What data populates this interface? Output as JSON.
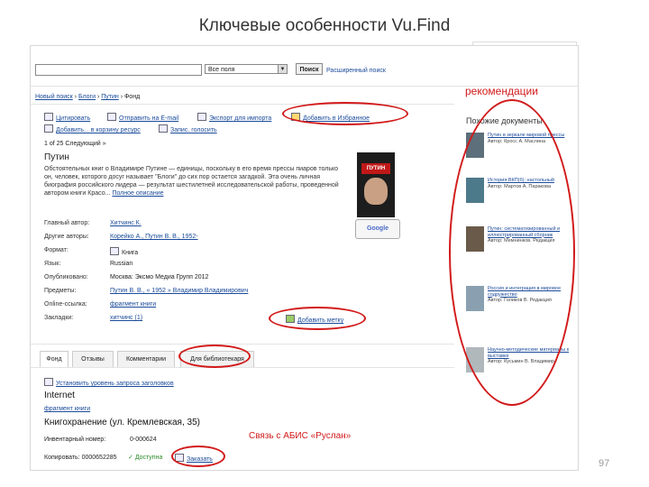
{
  "slide": {
    "title": "Ключевые особенности Vu.Find",
    "page_number": "97"
  },
  "search": {
    "scope": "Все поля",
    "button": "Поиск",
    "advanced": "Расширенный поиск"
  },
  "breadcrumb": [
    "Новый поиск",
    "Блоги",
    "Путин",
    "Фонд"
  ],
  "toolbar": {
    "row1": [
      "Цитировать",
      "Отправить на E-mail",
      "Экспорт для импорта",
      "Добавить в Избранное"
    ],
    "row2": [
      "Добавить... в корзину ресурс",
      "Запис. голосить"
    ]
  },
  "pager": {
    "text": "1 of 25 Следующий »"
  },
  "record": {
    "title": "Путин",
    "description": "Обстоятельных книг о Владимире Путине — единицы, поскольку в его время прессы пиаров только он, человек, которого досуг называет \"Блоги\" до сих пор остается загадкой. Эта очень личная биография российского лидера — результат шестилетней исследовательской работы, проведенной автором книги Красо...",
    "more": "Полное описание",
    "cover_label": "ПУТИН",
    "google_preview": "Google",
    "fields": [
      {
        "label": "Главный автор:",
        "value": "Хитчинс К."
      },
      {
        "label": "Другие авторы:",
        "value": "Корейко А., Путин В. В., 1952-"
      },
      {
        "label": "Формат:",
        "value": "Книга"
      },
      {
        "label": "Язык:",
        "value": "Russian"
      },
      {
        "label": "Опубликовано:",
        "value": "Москва: Эксмо Медиа Групп 2012"
      },
      {
        "label": "Предметы:",
        "value": "Путин В. В., « 1952 » Владимир Владимирович"
      },
      {
        "label": "Online-ссылка:",
        "value": "фрагмент книги"
      },
      {
        "label": "Закладки:",
        "value": "хитчинс (1)"
      }
    ],
    "add_tag": "Добавить метку"
  },
  "tabs": [
    "Фонд",
    "Отзывы",
    "Комментарии",
    "Для библиотекаря"
  ],
  "holdings": {
    "request_link": "Установить уровень запроса заголовков",
    "internet": "Internet",
    "fragment": "фрагмент книги",
    "location": "Книгохранение (ул. Кремлевская, 35)",
    "inv_label": "Инвентарный номер:",
    "inv_value": "0-000624",
    "copy_label": "Копировать: 0000652285",
    "available": "Доступна",
    "order": "Заказать"
  },
  "sidebar": {
    "title": "Похожие документы",
    "items": [
      {
        "title": "Путин в зеркале мировой прессы",
        "meta": "Автор: Кросс А. Маслина"
      },
      {
        "title": "История ВКП(б): настольный",
        "meta": "Автор: Мартов А. Паракова"
      },
      {
        "title": "Путин: систематизированный и иллюстрированный сборник",
        "meta": "Автор: Мемнинков. Редакция"
      },
      {
        "title": "Россия и интеграция в мировое содружество",
        "meta": "Автор: Голиков В. Редакция"
      },
      {
        "title": "Научно-методические материалы к выставке",
        "meta": "Автор: Кусьмин В. Владимир"
      }
    ]
  },
  "annotations": {
    "recommendations": "рекомендации",
    "abis": "Связь с АБИС «Руслан»"
  },
  "colors": {
    "annotation": "#d21a1a",
    "link": "#1a4a9a"
  }
}
